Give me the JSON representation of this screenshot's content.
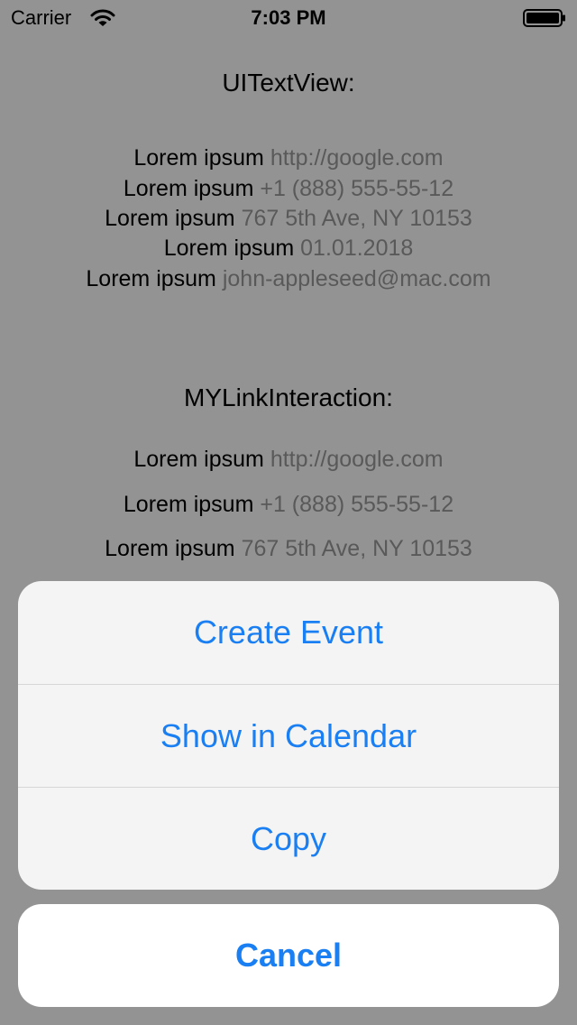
{
  "status_bar": {
    "carrier": "Carrier",
    "time": "7:03 PM",
    "wifi_icon": "wifi-icon",
    "battery_icon": "battery-icon"
  },
  "textview_section": {
    "heading": "UITextView:",
    "rows": [
      {
        "prefix": "Lorem ipsum",
        "link": "http://google.com"
      },
      {
        "prefix": "Lorem ipsum",
        "link": "+1 (888) 555-55-12"
      },
      {
        "prefix": "Lorem ipsum",
        "link": "767 5th Ave, NY 10153"
      },
      {
        "prefix": "Lorem ipsum",
        "link": "01.01.2018"
      },
      {
        "prefix": "Lorem ipsum",
        "link": "john-appleseed@mac.com"
      }
    ]
  },
  "interaction_section": {
    "heading": "MYLinkInteraction:",
    "rows": [
      {
        "prefix": "Lorem ipsum",
        "link": "http://google.com"
      },
      {
        "prefix": "Lorem ipsum",
        "link": "+1 (888) 555-55-12"
      },
      {
        "prefix": "Lorem ipsum",
        "link": "767 5th Ave, NY 10153"
      }
    ]
  },
  "action_sheet": {
    "actions": [
      {
        "label": "Create Event"
      },
      {
        "label": "Show in Calendar"
      },
      {
        "label": "Copy"
      }
    ],
    "cancel_label": "Cancel"
  },
  "colors": {
    "dimmed_background": "#939393",
    "action_tint": "#1a7ff2",
    "detected_link_text": "#595959"
  }
}
